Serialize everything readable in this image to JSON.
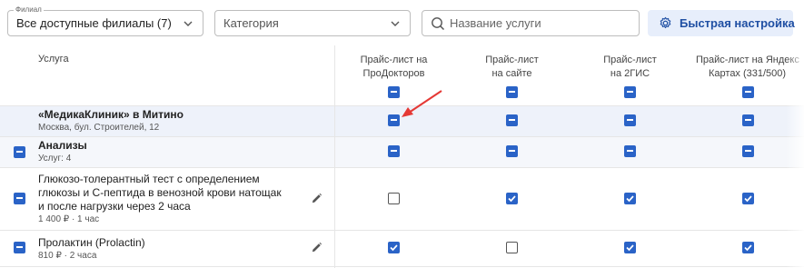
{
  "filters": {
    "branch_label": "Филиал",
    "branch_value": "Все доступные филиалы (7)",
    "category_placeholder": "Категория",
    "search_placeholder": "Название услуги",
    "quick_setup_label": "Быстрая настройка"
  },
  "table": {
    "service_header": "Услуга",
    "columns": [
      {
        "line1": "Прайс-лист на",
        "line2": "ПроДокторов"
      },
      {
        "line1": "Прайс-лист",
        "line2": "на сайте"
      },
      {
        "line1": "Прайс-лист",
        "line2": "на 2ГИС"
      },
      {
        "line1": "Прайс-лист на Яндекс",
        "line2": "Картах (331/500)"
      }
    ],
    "clinic": {
      "name": "«МедикаКлиник» в Митино",
      "address": "Москва, бул. Строителей, 12"
    },
    "group": {
      "name": "Анализы",
      "count": "Услуг: 4"
    },
    "services": [
      {
        "name_lines": [
          "Глюкозо-толерантный тест с определением",
          "глюкозы и С-пептида в венозной крови натощак",
          "и после нагрузки через 2 часа"
        ],
        "meta": "1 400 ₽ · 1 час",
        "states": [
          "unchecked",
          "checked",
          "checked",
          "checked"
        ]
      },
      {
        "name_lines": [
          "Пролактин (Prolactin)"
        ],
        "meta": "810 ₽ · 2 часа",
        "states": [
          "checked",
          "unchecked",
          "checked",
          "checked"
        ]
      }
    ]
  },
  "colors": {
    "accent": "#2a63c7",
    "button_bg": "#e7eefb",
    "button_text": "#1f4fa3",
    "highlight_row": "#eef2fa",
    "arrow": "#e53935"
  }
}
